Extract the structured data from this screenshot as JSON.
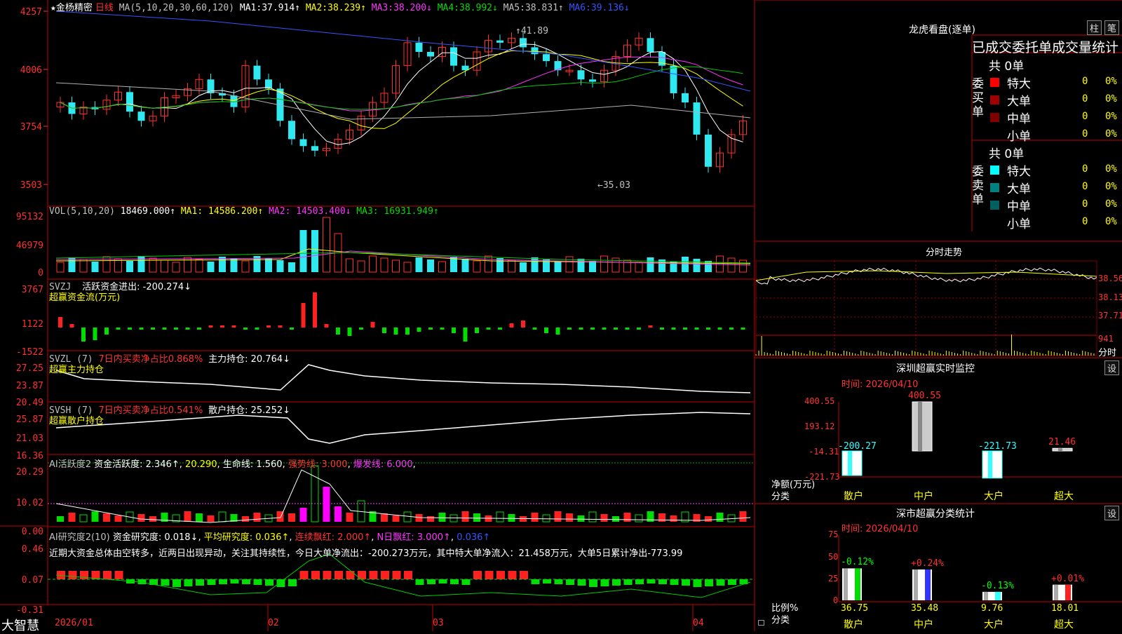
{
  "colors": {
    "up": "#ff3030",
    "down": "#30e8f0",
    "ma1": "#ffffff",
    "ma2": "#ffff00",
    "ma3": "#ff33ff",
    "ma4": "#00cc00",
    "ma5": "#b0b0b0",
    "ma6": "#3355ff",
    "grid": "#800000",
    "border": "#c00000"
  },
  "kline": {
    "star": "★",
    "stock_name": "金杨精密",
    "period": "日线",
    "ma_params": "MA(5,10,20,30,60,120)",
    "ma_values": [
      {
        "label": "MA1:",
        "value": "37.914↑"
      },
      {
        "label": "MA2:",
        "value": "38.239↑"
      },
      {
        "label": "MA3:",
        "value": "38.200↓"
      },
      {
        "label": "MA4:",
        "value": "38.992↓"
      },
      {
        "label": "MA5:",
        "value": "38.831↑"
      },
      {
        "label": "MA6:",
        "value": "39.136↓"
      }
    ],
    "y_ticks": [
      "4257",
      "4006",
      "3754",
      "3503"
    ],
    "high_mark": "41.89",
    "low_mark": "35.03"
  },
  "volume": {
    "title": "VOL(5,10,20)",
    "value": "18469.000↑",
    "ma1": "MA1: 14586.200↑",
    "ma2": "MA2: 14503.400↓",
    "ma3": "MA3: 16931.949↑",
    "y_ticks": [
      "95132",
      "46979",
      "0"
    ]
  },
  "svzj": {
    "title": "SVZJ",
    "label": "活跃资金进出: -200.274↓",
    "subtitle": "超赢资金流(万元)",
    "y_ticks": [
      "3767",
      "1122",
      "-1522"
    ]
  },
  "svzl": {
    "title": "SVZL (7)",
    "label1": "7日内买卖净占比0.868%",
    "label2": "主力持仓: 20.764↓",
    "subtitle": "超赢主力持仓",
    "y_ticks": [
      "27.25",
      "23.87",
      "20.49"
    ]
  },
  "svsh": {
    "title": "SVSH (7)",
    "label1": "7日内买卖净占比0.541%",
    "label2": "散户持仓: 25.252↓",
    "subtitle": "超赢散户持仓",
    "y_ticks": [
      "25.87",
      "21.03",
      "16.36"
    ]
  },
  "ai_active": {
    "title": "AI活跃度2",
    "label1": "资金活跃度: 2.346↑",
    "label2": "20.290",
    "label3": "生命线: 1.560",
    "label4": "强势线: 3.000",
    "label5": "爆发线: 6.000",
    "y_ticks": [
      "20.29",
      "10.02",
      "0.00"
    ]
  },
  "ai_research": {
    "title": "AI研究度2(10)",
    "label1": "资金研究度: 0.018↓",
    "label2": "平均研究度: 0.036↑",
    "label3": "连续飘红: 2.000↑",
    "label4": "N日飘红: 3.000↑",
    "label5": "0.036↑",
    "comment": "近期大资金总体由空转多，近两日出现异动，关注其持续性，今日大单净流出：-200.273万元，其中特大单净流入：21.458万元，大单5日累计净出-773.99",
    "y_ticks": [
      "0.46",
      "0.07",
      "-0.31"
    ]
  },
  "dates": [
    "2026/01",
    "02",
    "03",
    "04"
  ],
  "brand": "大智慧",
  "lhb": {
    "title": "龙虎看盘(逐单)",
    "btn1": "柱",
    "btn2": "笔",
    "tabs": "已成交委托单成交量统计",
    "buy": {
      "header": "共 0单",
      "side_label": "委买单",
      "rows": [
        {
          "name": "特大",
          "count": "0",
          "pct": "0%",
          "color": "#ff0000"
        },
        {
          "name": "大单",
          "count": "0",
          "pct": "0%",
          "color": "#a00000"
        },
        {
          "name": "中单",
          "count": "0",
          "pct": "0%",
          "color": "#800000"
        },
        {
          "name": "小单",
          "count": "0",
          "pct": "0%",
          "color": ""
        }
      ]
    },
    "sell": {
      "header": "共 0单",
      "side_label": "委卖单",
      "rows": [
        {
          "name": "特大",
          "count": "0",
          "pct": "0%",
          "color": "#00ffff"
        },
        {
          "name": "大单",
          "count": "0",
          "pct": "0%",
          "color": "#008080"
        },
        {
          "name": "中单",
          "count": "0",
          "pct": "0%",
          "color": "#006060"
        },
        {
          "name": "小单",
          "count": "0",
          "pct": "0%",
          "color": ""
        }
      ]
    }
  },
  "intraday": {
    "title": "分时走势",
    "y_ticks": [
      "38.56",
      "38.13",
      "37.71"
    ],
    "vol_tick": "941",
    "vol_label": "分时"
  },
  "monitor": {
    "title": "深圳超赢实时监控",
    "btn": "设",
    "time": "时间: 2026/04/10",
    "y_ticks": [
      "400.55",
      "193.12",
      "-14.31",
      "-221.73"
    ],
    "ylabel1": "净额(万元)",
    "ylabel2": "分类",
    "bars": [
      {
        "cat": "散户",
        "value": -200.27,
        "label": "-200.27"
      },
      {
        "cat": "中户",
        "value": 400.55,
        "label": "400.55"
      },
      {
        "cat": "大户",
        "value": -221.73,
        "label": "-221.73"
      },
      {
        "cat": "超大",
        "value": 21.46,
        "label": "21.46"
      }
    ]
  },
  "classify": {
    "title": "深市超赢分类统计",
    "btn": "设",
    "time": "时间: 2026/04/10",
    "y_ticks": [
      "75",
      "50",
      "25",
      "0"
    ],
    "ylabel1": "比例%",
    "ylabel2": "分类",
    "bars": [
      {
        "cat": "散户",
        "value": 36.75,
        "label": "36.75",
        "change": "-0.12%"
      },
      {
        "cat": "中户",
        "value": 35.48,
        "label": "35.48",
        "change": "+0.24%"
      },
      {
        "cat": "大户",
        "value": 9.76,
        "label": "9.76",
        "change": "-0.13%"
      },
      {
        "cat": "超大",
        "value": 18.01,
        "label": "18.01",
        "change": "+0.01%"
      }
    ]
  }
}
